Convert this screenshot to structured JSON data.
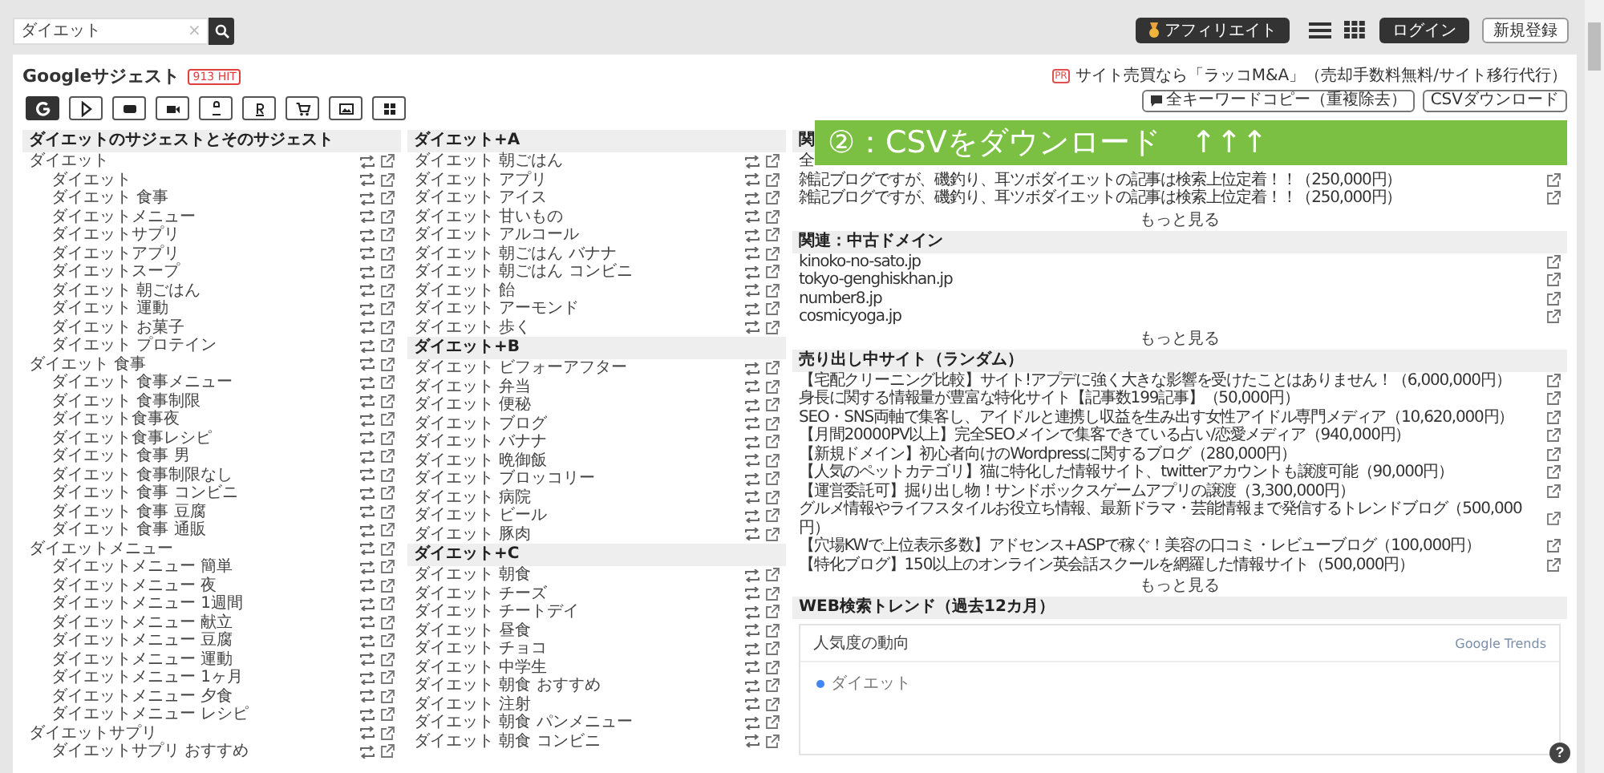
{
  "topbar": {
    "search": {
      "value": "ダイエット",
      "clear": "×"
    },
    "affiliate": "アフィリエイト",
    "login": "ログイン",
    "register": "新規登録"
  },
  "header": {
    "title": "Googleサジェスト",
    "hits": "913 HIT",
    "pr": {
      "badge": "PR",
      "text": "サイト売買なら「ラッコM&A」（売却手数料無料/サイト移行代行）"
    },
    "copy_all": "全キーワードコピー（重複除去）",
    "csv": "CSVダウンロード",
    "sources": [
      {
        "kind": "google",
        "selected": true
      },
      {
        "kind": "play",
        "selected": false
      },
      {
        "kind": "youtube",
        "selected": false
      },
      {
        "kind": "video",
        "selected": false
      },
      {
        "kind": "amazon",
        "selected": false
      },
      {
        "kind": "rakuten",
        "selected": false
      },
      {
        "kind": "cart",
        "selected": false
      },
      {
        "kind": "image",
        "selected": false
      },
      {
        "kind": "apps",
        "selected": false
      }
    ]
  },
  "suggest": {
    "title": "ダイエットのサジェストとそのサジェスト",
    "items": [
      {
        "text": "ダイエット",
        "children": [
          {
            "text": "ダイエット"
          },
          {
            "text": "ダイエット 食事"
          },
          {
            "text": "ダイエットメニュー"
          },
          {
            "text": "ダイエットサプリ"
          },
          {
            "text": "ダイエットアプリ"
          },
          {
            "text": "ダイエットスープ"
          },
          {
            "text": "ダイエット 朝ごはん"
          },
          {
            "text": "ダイエット 運動"
          },
          {
            "text": "ダイエット お菓子"
          },
          {
            "text": "ダイエット プロテイン"
          }
        ]
      },
      {
        "text": "ダイエット 食事",
        "children": [
          {
            "text": "ダイエット 食事メニュー"
          },
          {
            "text": "ダイエット 食事制限"
          },
          {
            "text": "ダイエット食事夜"
          },
          {
            "text": "ダイエット食事レシピ"
          },
          {
            "text": "ダイエット 食事 男"
          },
          {
            "text": "ダイエット 食事制限なし"
          },
          {
            "text": "ダイエット 食事 コンビニ"
          },
          {
            "text": "ダイエット 食事 豆腐"
          },
          {
            "text": "ダイエット 食事 通販"
          }
        ]
      },
      {
        "text": "ダイエットメニュー",
        "children": [
          {
            "text": "ダイエットメニュー 簡単"
          },
          {
            "text": "ダイエットメニュー 夜"
          },
          {
            "text": "ダイエットメニュー 1週間"
          },
          {
            "text": "ダイエットメニュー 献立"
          },
          {
            "text": "ダイエットメニュー 豆腐"
          },
          {
            "text": "ダイエットメニュー 運動"
          },
          {
            "text": "ダイエットメニュー 1ヶ月"
          },
          {
            "text": "ダイエットメニュー 夕食"
          },
          {
            "text": "ダイエットメニュー レシピ"
          }
        ]
      },
      {
        "text": "ダイエットサプリ",
        "children": [
          {
            "text": "ダイエットサプリ おすすめ"
          }
        ]
      }
    ]
  },
  "alphabet": [
    {
      "title": "ダイエット+A",
      "items": [
        "ダイエット 朝ごはん",
        "ダイエット アプリ",
        "ダイエット アイス",
        "ダイエット 甘いもの",
        "ダイエット アルコール",
        "ダイエット 朝ごはん バナナ",
        "ダイエット 朝ごはん コンビニ",
        "ダイエット 飴",
        "ダイエット アーモンド",
        "ダイエット 歩く"
      ]
    },
    {
      "title": "ダイエット+B",
      "items": [
        "ダイエット ビフォーアフター",
        "ダイエット 弁当",
        "ダイエット 便秘",
        "ダイエット ブログ",
        "ダイエット バナナ",
        "ダイエット 晩御飯",
        "ダイエット ブロッコリー",
        "ダイエット 病院",
        "ダイエット ビール",
        "ダイエット 豚肉"
      ]
    },
    {
      "title": "ダイエット+C",
      "items": [
        "ダイエット 朝食",
        "ダイエット チーズ",
        "ダイエット チートデイ",
        "ダイエット 昼食",
        "ダイエット チョコ",
        "ダイエット 中学生",
        "ダイエット 朝食 おすすめ",
        "ダイエット 注射",
        "ダイエット 朝食 パンメニュー",
        "ダイエット 朝食 コンビニ"
      ]
    }
  ],
  "related": [
    {
      "title": "関",
      "rows": [
        {
          "text": "全",
          "link": false
        },
        {
          "text": "雑記ブログですが、磯釣り、耳ツボダイエットの記事は検索上位定着！！（250,000円）",
          "link": true
        },
        {
          "text": "雑記ブログですが、磯釣り、耳ツボダイエットの記事は検索上位定着！！（250,000円）",
          "link": true
        }
      ],
      "more": "もっと見る"
    },
    {
      "title": "関連：中古ドメイン",
      "rows": [
        {
          "text": "kinoko-no-sato.jp",
          "link": true
        },
        {
          "text": "tokyo-genghiskhan.jp",
          "link": true
        },
        {
          "text": "number8.jp",
          "link": true
        },
        {
          "text": "cosmicyoga.jp",
          "link": true
        }
      ],
      "more": "もっと見る"
    },
    {
      "title": "売り出し中サイト（ランダム）",
      "rows": [
        {
          "text": "【宅配クリーニング比較】サイト!アプデに強く大きな影響を受けたことはありません！（6,000,000円）",
          "link": true
        },
        {
          "text": "身長に関する情報量が豊富な特化サイト【記事数199記事】（50,000円）",
          "link": true
        },
        {
          "text": "SEO・SNS両軸で集客し、アイドルと連携し収益を生み出す女性アイドル専門メディア（10,620,000円）",
          "link": true
        },
        {
          "text": "【月間20000PV以上】完全SEOメインで集客できている占い/恋愛メディア（940,000円）",
          "link": true
        },
        {
          "text": "【新規ドメイン】初心者向けのWordpressに関するブログ（280,000円）",
          "link": true
        },
        {
          "text": "【人気のペットカテゴリ】猫に特化した情報サイト、twitterアカウントも譲渡可能（90,000円）",
          "link": true
        },
        {
          "text": "【運営委託可】掘り出し物！サンドボックスゲームアプリの譲渡（3,300,000円）",
          "link": true
        },
        {
          "text": "グルメ情報やライフスタイルお役立ち情報、最新ドラマ・芸能情報まで発信するトレンドブログ（500,000円）",
          "link": true
        },
        {
          "text": "【穴場KWで上位表示多数】アドセンス+ASPで稼ぐ！美容の口コミ・レビューブログ（100,000円）",
          "link": true
        },
        {
          "text": "【特化ブログ】150以上のオンライン英会話スクールを網羅した情報サイト（500,000円）",
          "link": true
        }
      ],
      "more": "もっと見る"
    }
  ],
  "trends": {
    "title": "WEB検索トレンド（過去12カ月）",
    "heading": "人気度の動向",
    "brand": "Google Trends",
    "legend": [
      {
        "label": "ダイエット",
        "color": "#4285f4"
      }
    ]
  },
  "banner": "②：CSVをダウンロード　↑↑↑",
  "help": "?"
}
